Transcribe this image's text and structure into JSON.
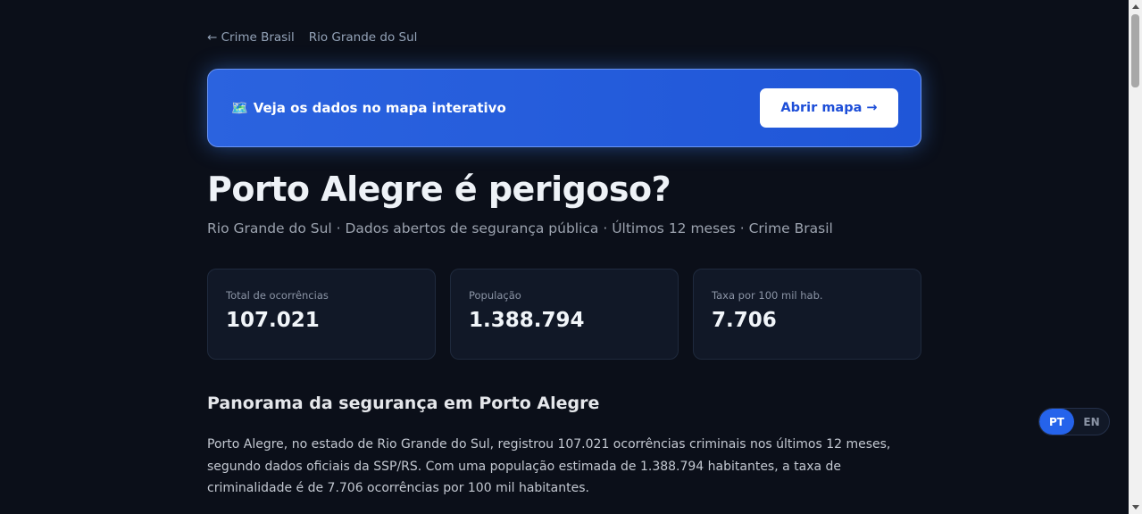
{
  "breadcrumb": {
    "back_label": "← Crime Brasil",
    "current_label": "Rio Grande do Sul"
  },
  "banner": {
    "icon": "🗺️",
    "text": "Veja os dados no mapa interativo",
    "button_label": "Abrir mapa →"
  },
  "page": {
    "title": "Porto Alegre é perigoso?",
    "subtitle": "Rio Grande do Sul · Dados abertos de segurança pública · Últimos 12 meses · Crime Brasil"
  },
  "stats": [
    {
      "label": "Total de ocorrências",
      "value": "107.021"
    },
    {
      "label": "População",
      "value": "1.388.794"
    },
    {
      "label": "Taxa por 100 mil hab.",
      "value": "7.706"
    }
  ],
  "section": {
    "title": "Panorama da segurança em Porto Alegre",
    "paragraph": "Porto Alegre, no estado de Rio Grande do Sul, registrou 107.021 ocorrências criminais nos últimos 12 meses, segundo dados oficiais da SSP/RS. Com uma população estimada de 1.388.794 habitantes, a taxa de criminalidade é de 7.706 ocorrências por 100 mil habitantes."
  },
  "language": {
    "options": [
      "PT",
      "EN"
    ],
    "active": "PT"
  },
  "colors": {
    "background": "#0b0f19",
    "banner": "#2563eb",
    "card": "#111827",
    "accent": "#2563eb"
  }
}
